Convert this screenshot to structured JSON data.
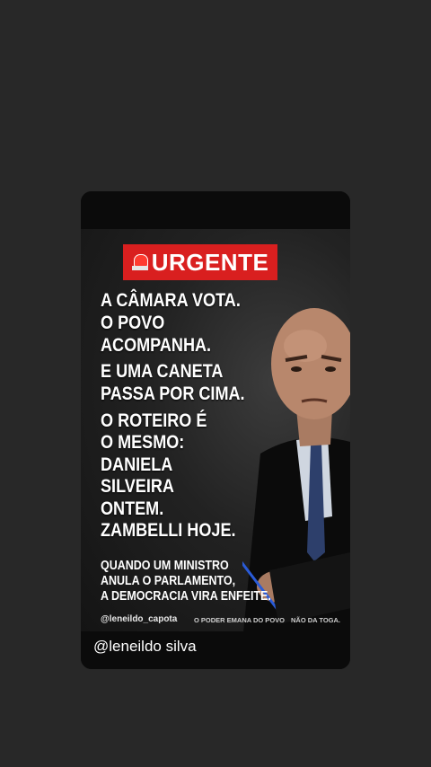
{
  "banner": {
    "label": "URGENTE",
    "icon": "siren-icon"
  },
  "headline_lines": [
    "A CÂMARA VOTA.",
    "O POVO",
    "ACOMPANHA.",
    "E UMA CANETA",
    "PASSA POR CIMA.",
    "O ROTEIRO É",
    "O MESMO:",
    "DANIELA",
    "SILVEIRA",
    "ONTEM.",
    "ZAMBELLI HOJE."
  ],
  "subtext_lines": [
    "QUANDO UM MINISTRO",
    "ANULA O PARLAMENTO,",
    "A DEMOCRACIA VIRA ENFEITE."
  ],
  "footer": {
    "handle": "@leneildo_capota",
    "tagline_1": "O PODER EMANA DO POVO",
    "tagline_2": "NÃO DA TOGA."
  },
  "caption": "@leneildo silva",
  "colors": {
    "banner": "#d91f1f",
    "background": "#282828"
  }
}
